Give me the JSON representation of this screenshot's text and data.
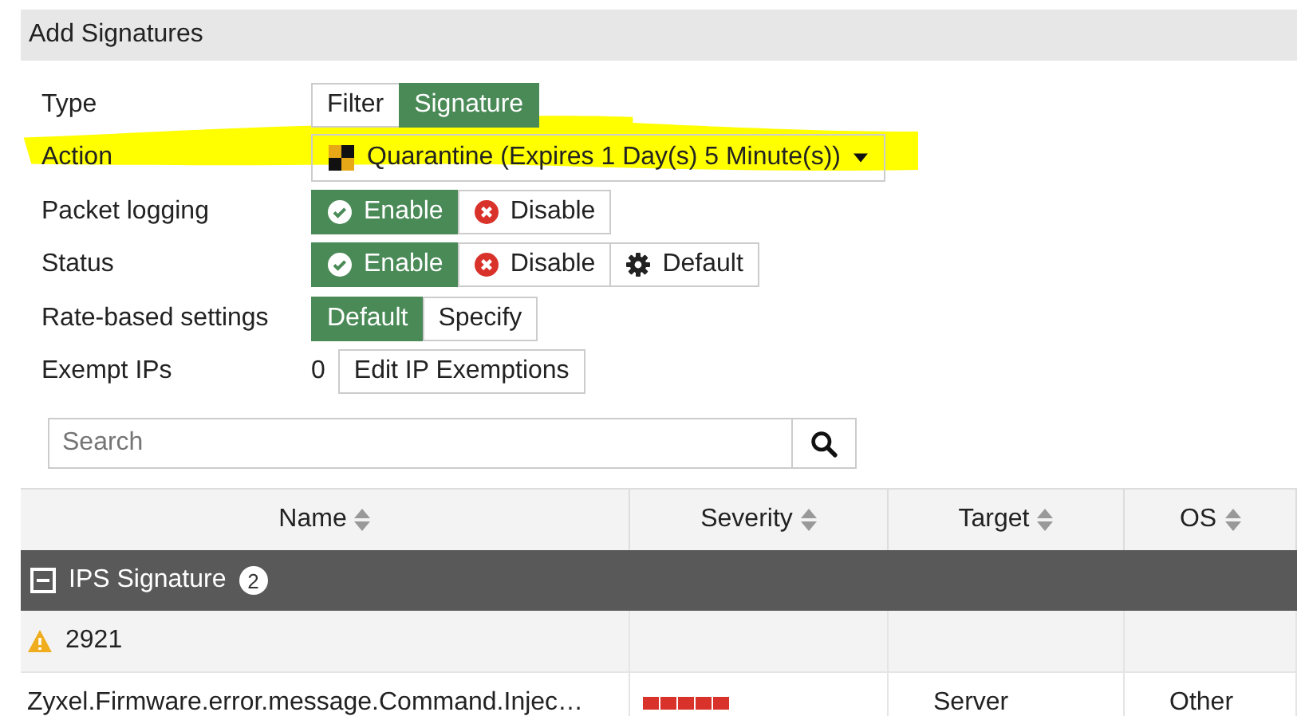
{
  "header": {
    "title": "Add Signatures"
  },
  "fields": [
    {
      "label": "Type",
      "kind": "segmented",
      "options": [
        {
          "label": "Filter",
          "selected": false
        },
        {
          "label": "Signature",
          "selected": true
        }
      ]
    },
    {
      "label": "Action",
      "kind": "dropdown",
      "value": "Quarantine (Expires 1 Day(s) 5 Minute(s))"
    },
    {
      "label": "Packet logging",
      "kind": "segmented",
      "options": [
        {
          "label": "Enable",
          "kind": "enable",
          "selected": true
        },
        {
          "label": "Disable",
          "kind": "disable",
          "selected": false
        }
      ]
    },
    {
      "label": "Status",
      "kind": "segmented",
      "options": [
        {
          "label": "Enable",
          "kind": "enable",
          "selected": true
        },
        {
          "label": "Disable",
          "kind": "disable",
          "selected": false
        },
        {
          "label": "Default",
          "kind": "default",
          "selected": false
        }
      ]
    },
    {
      "label": "Rate-based settings",
      "kind": "segmented",
      "options": [
        {
          "label": "Default",
          "selected": true
        },
        {
          "label": "Specify",
          "selected": false
        }
      ]
    },
    {
      "label": "Exempt IPs",
      "kind": "exempt",
      "count": "0",
      "button": "Edit IP Exemptions"
    }
  ],
  "search": {
    "placeholder": "Search"
  },
  "table": {
    "columns": [
      "Name",
      "Severity",
      "Target",
      "OS"
    ],
    "group": {
      "label": "IPS Signature",
      "count": "2",
      "expanded": true
    },
    "rows": [
      {
        "kind": "warning",
        "name": "2921"
      },
      {
        "kind": "signature",
        "name": "Zyxel.Firmware.error.message.Command.Injec…",
        "stars": 5,
        "target": "Server",
        "os": "Other"
      }
    ]
  }
}
